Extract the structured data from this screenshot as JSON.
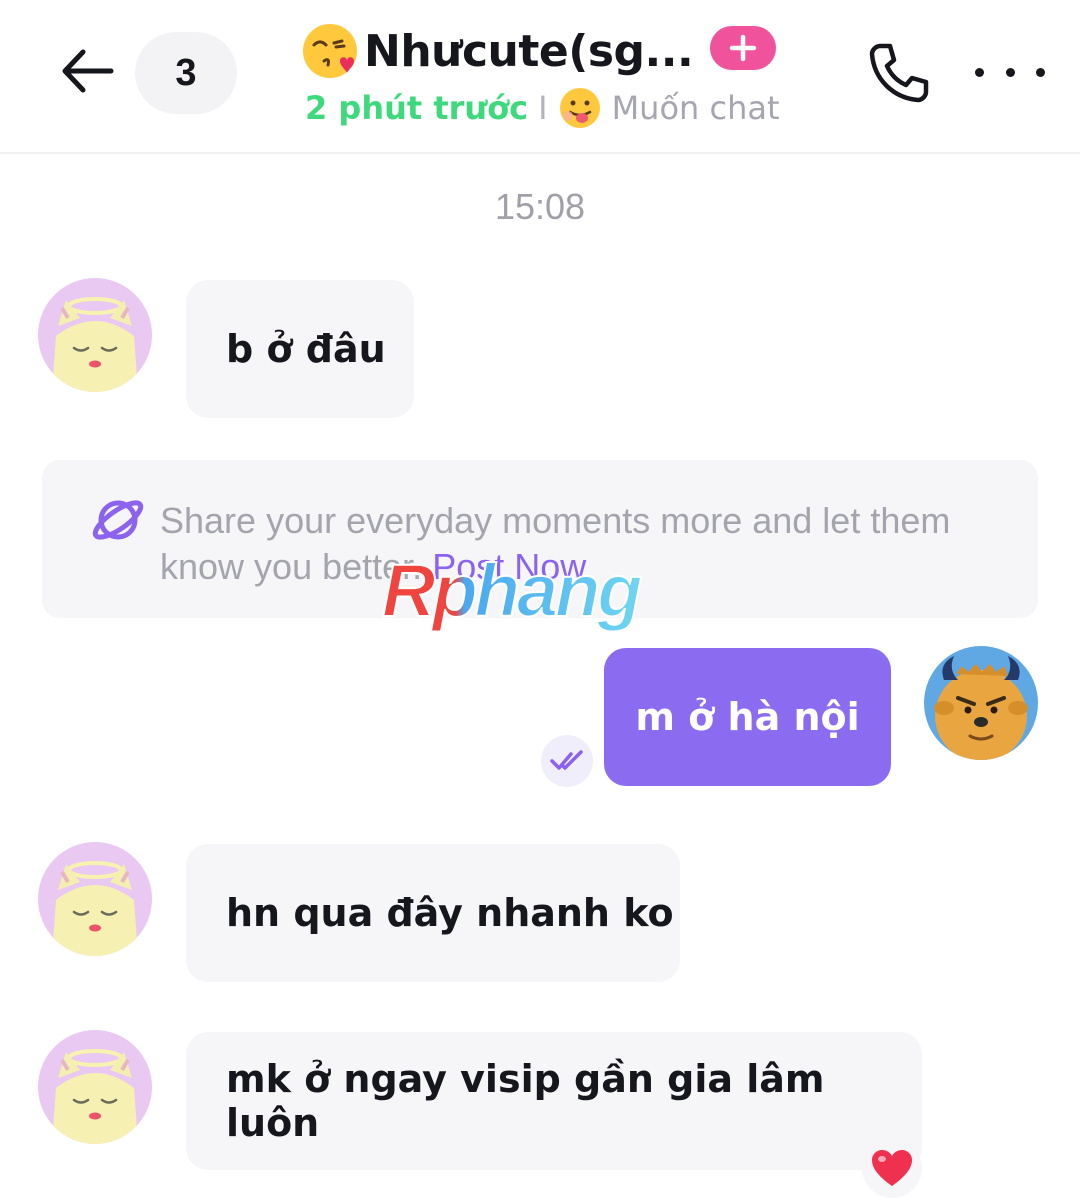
{
  "header": {
    "back_icon": "arrow-left-icon",
    "unread_count": "3",
    "title_emoji": "kissing-face-emoji",
    "title": "Nhưcute(sg...",
    "add_icon": "plus-icon",
    "status_time": "2 phút trước",
    "separator": "I",
    "mood_emoji": "tongue-face-emoji",
    "mood_text": "Muốn chat",
    "call_icon": "phone-icon",
    "more_icon": "more-dots-icon"
  },
  "chat": {
    "time": "15:08",
    "messages": [
      {
        "side": "in",
        "text": "b ở đâu"
      },
      {
        "side": "out",
        "text": "m ở hà nội"
      },
      {
        "side": "in",
        "text": "hn qua đây nhanh ko"
      },
      {
        "side": "in",
        "text": "mk ở ngay visip gần gia lâm luôn",
        "reaction": "heart"
      }
    ],
    "share_card": {
      "text": "Share your everyday moments more and let them know you better.",
      "link": "Post Now"
    },
    "watermark": "Rphang"
  },
  "colors": {
    "accent_purple": "#8b6cf0",
    "online_green": "#3fd97d",
    "add_pink": "#f0529c",
    "bubble_gray": "#f6f6f9"
  }
}
